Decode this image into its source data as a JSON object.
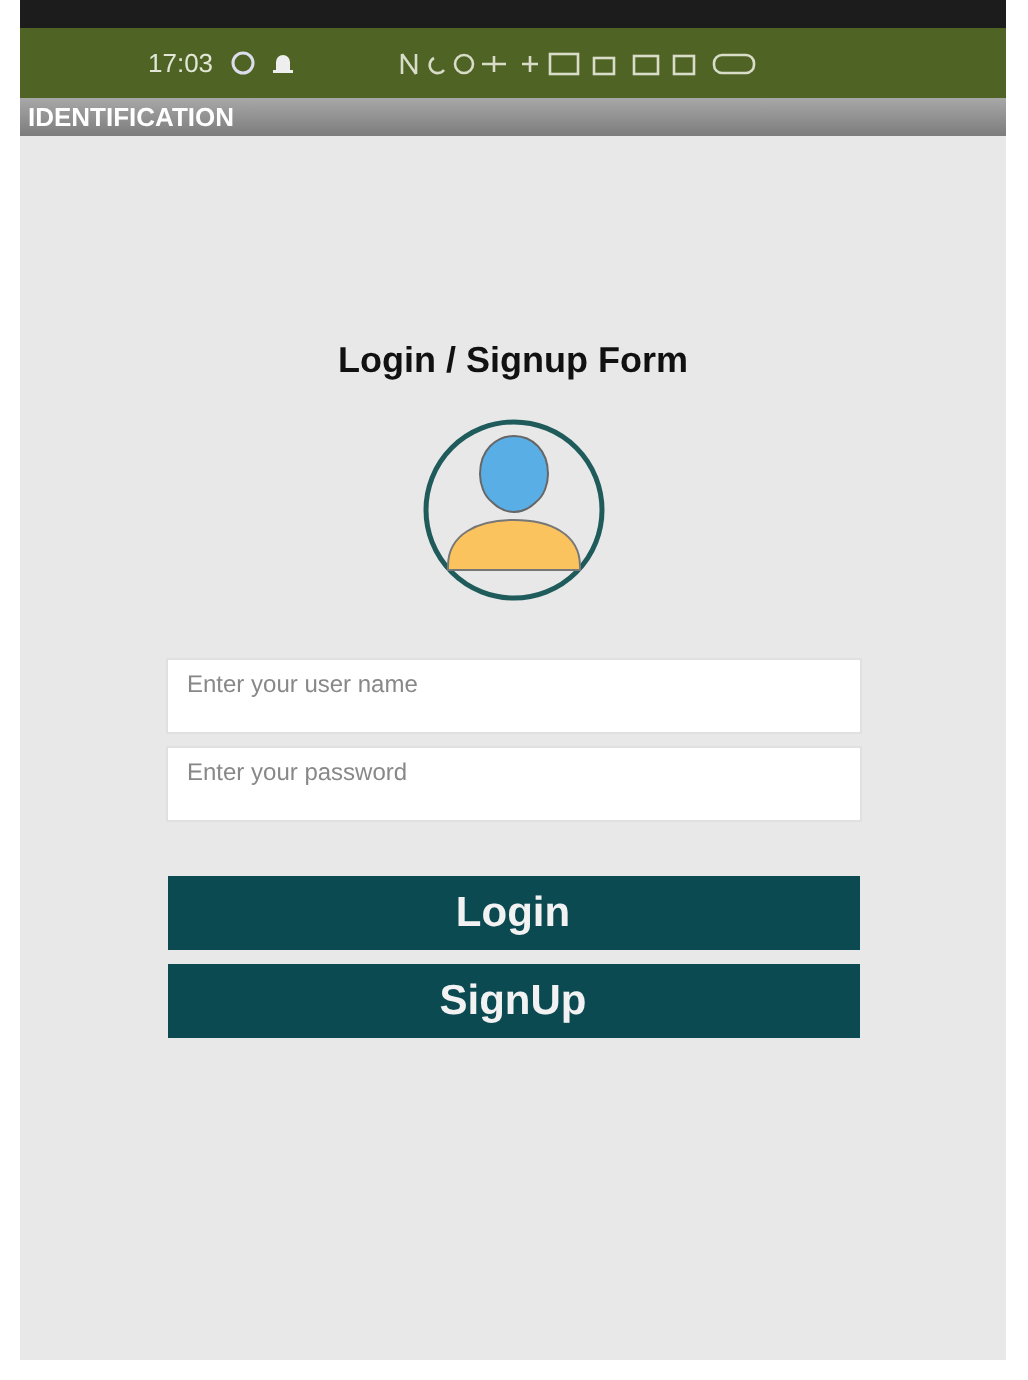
{
  "status_bar": {
    "time": "17:03"
  },
  "app_bar": {
    "title": "IDENTIFICATION"
  },
  "form": {
    "title": "Login / Signup Form",
    "fields": [
      {
        "placeholder": "Enter your user name"
      },
      {
        "placeholder": "Enter your password"
      }
    ],
    "buttons": [
      "Login",
      "SignUp"
    ]
  }
}
